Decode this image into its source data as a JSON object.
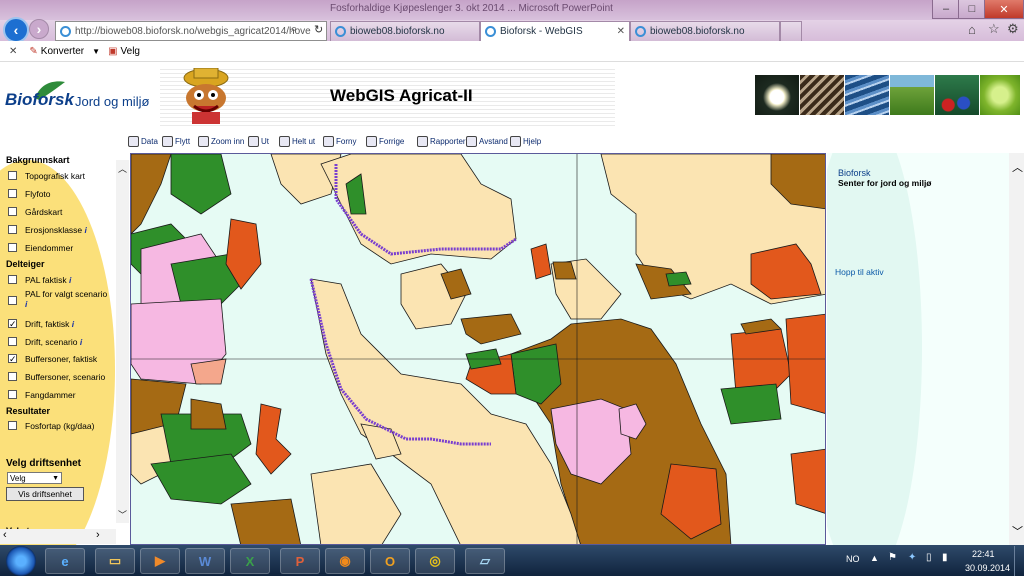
{
  "browser": {
    "window_title": "Fosforhaldige Kjøpeslenger 3. okt 2014 ... Microsoft PowerPoint",
    "address": "http://bioweb08.bioforsk.no/webgis_agricat2014/hove",
    "tabs": [
      {
        "label": "bioweb08.bioforsk.no",
        "active": false
      },
      {
        "label": "Bioforsk - WebGIS",
        "active": true
      },
      {
        "label": "bioweb08.bioforsk.no",
        "active": false
      }
    ],
    "command_bar": {
      "close": "✕",
      "convert": "Konverter",
      "select": "Velg"
    }
  },
  "header": {
    "logo_brand": "Bioforsk",
    "logo_tagline": "Jord og miljø",
    "app_title": "WebGIS Agricat-II"
  },
  "toolbar": {
    "tools": [
      {
        "label": "Data",
        "icon": "data-icon"
      },
      {
        "label": "Flytt",
        "icon": "hand-icon"
      },
      {
        "label": "Zoom inn",
        "icon": "zoom-in-icon"
      },
      {
        "label": "Ut",
        "icon": "zoom-out-icon"
      },
      {
        "label": "Helt ut",
        "icon": "full-extent-icon"
      },
      {
        "label": "Forny",
        "icon": "refresh-icon"
      },
      {
        "label": "Forrige",
        "icon": "previous-icon"
      },
      {
        "label": "Rapporter",
        "icon": "printer-icon"
      },
      {
        "label": "Avstand",
        "icon": "measure-icon"
      },
      {
        "label": "Hjelp",
        "icon": "help-icon"
      }
    ]
  },
  "layers": {
    "background_heading": "Bakgrunnskart",
    "background": [
      {
        "label": "Topografisk kart",
        "checked": false
      },
      {
        "label": "Flyfoto",
        "checked": false
      },
      {
        "label": "Gårdskart",
        "checked": false
      },
      {
        "label": "Erosjonsklasse",
        "checked": false,
        "info": "i"
      },
      {
        "label": "Eiendommer",
        "checked": false
      }
    ],
    "subtheme_heading": "Delteiger",
    "subthemes": [
      {
        "label": "PAL faktisk",
        "checked": false,
        "info": "i"
      },
      {
        "label": "PAL for valgt scenario",
        "checked": false,
        "info": "i"
      },
      {
        "label": "Drift, faktisk",
        "checked": true,
        "info": "i"
      },
      {
        "label": "Drift, scenario",
        "checked": false,
        "info": "i"
      },
      {
        "label": "Buffersoner, faktisk",
        "checked": true
      },
      {
        "label": "Buffersoner, scenario",
        "checked": false
      },
      {
        "label": "Fangdammer",
        "checked": false
      }
    ],
    "results_heading": "Resultater",
    "results": [
      {
        "label": "Fosfortap (kg/daa)",
        "checked": false
      }
    ],
    "operation_unit_heading": "Velg driftsenhet",
    "select_value": "Velg",
    "show_button": "Vis driftsenhet",
    "cut_off_heading": "Vekste..."
  },
  "right_panel": {
    "org": "Bioforsk",
    "org_subtitle": "Senter for jord og miljø",
    "link": "Hopp til aktiv"
  },
  "taskbar": {
    "lang": "NO",
    "time": "22:41",
    "date": "30.09.2014",
    "apps": [
      "ie-icon",
      "explorer-icon",
      "media-player-icon",
      "word-icon",
      "excel-icon",
      "powerpoint-icon",
      "firefox-icon",
      "outlook-icon",
      "chrome-icon",
      "folder-icon"
    ]
  },
  "colors": {
    "cultivated": "#fbe4b2",
    "grass": "#2f8f2a",
    "forest": "#a56a14",
    "orange": "#e2581c",
    "pink": "#f6b8e2",
    "water": "#e6fbf4",
    "buffer": "#7a3fcf"
  }
}
